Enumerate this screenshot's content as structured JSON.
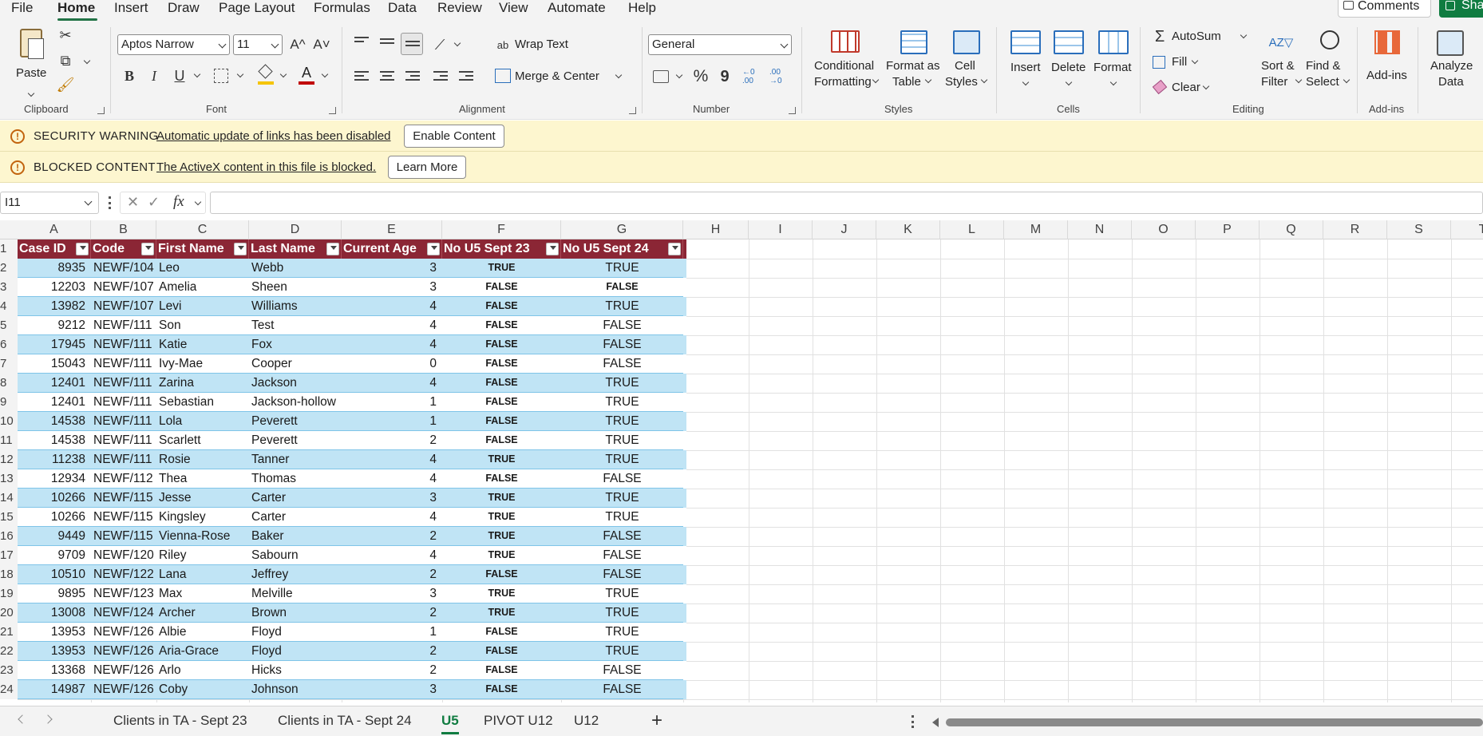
{
  "menu": {
    "tabs": [
      "File",
      "Home",
      "Insert",
      "Draw",
      "Page Layout",
      "Formulas",
      "Data",
      "Review",
      "View",
      "Automate",
      "Help"
    ],
    "comments_label": "Comments",
    "share_label": "Sha"
  },
  "ribbon": {
    "clipboard": {
      "paste_label": "Paste",
      "group_label": "Clipboard"
    },
    "font": {
      "font_name": "Aptos Narrow",
      "font_size": "11",
      "bold": "B",
      "italic": "I",
      "underline": "U",
      "grow": "A^",
      "shrink": "A˅",
      "font_color_letter": "A",
      "group_label": "Font",
      "fill_color": "#f5c400",
      "font_color": "#c00000"
    },
    "alignment": {
      "wrap_text": "Wrap Text",
      "merge_center": "Merge & Center",
      "group_label": "Alignment"
    },
    "number": {
      "format": "General",
      "percent": "%",
      "comma": "9",
      "inc_decimal": "←0 .00",
      "dec_decimal": ".00 →0",
      "group_label": "Number"
    },
    "styles": {
      "conditional_formatting": [
        "Conditional",
        "Formatting"
      ],
      "format_as_table": [
        "Format as",
        "Table"
      ],
      "cell_styles": [
        "Cell",
        "Styles"
      ],
      "group_label": "Styles"
    },
    "cells": {
      "insert": "Insert",
      "delete": "Delete",
      "format": "Format",
      "group_label": "Cells"
    },
    "editing": {
      "autosum": "AutoSum",
      "fill": "Fill",
      "clear": "Clear",
      "sort_filter": [
        "Sort &",
        "Filter"
      ],
      "find_select": [
        "Find &",
        "Select"
      ],
      "group_label": "Editing"
    },
    "addins": {
      "label": "Add-ins",
      "group_label": "Add-ins"
    },
    "analyze": {
      "label": [
        "Analyze",
        "Data"
      ]
    }
  },
  "messages": [
    {
      "title": "SECURITY WARNING",
      "text": "Automatic update of links has been disabled",
      "button": "Enable Content"
    },
    {
      "title": "BLOCKED CONTENT",
      "text": "The ActiveX content in this file is blocked.",
      "button": "Learn More"
    }
  ],
  "formula_bar": {
    "name_box": "I11",
    "fx": "fx",
    "formula": ""
  },
  "columns": [
    "A",
    "B",
    "C",
    "D",
    "E",
    "F",
    "G",
    "H",
    "I",
    "J",
    "K",
    "L",
    "M",
    "N",
    "O",
    "P",
    "Q",
    "R",
    "S",
    "T"
  ],
  "table": {
    "headers": [
      "Case ID",
      "Code",
      "First Name",
      "Last Name",
      "Current Age",
      "No U5 Sept 23",
      "No U5 Sept 24"
    ],
    "rows": [
      [
        "8935",
        "NEWF/104",
        "Leo",
        "Webb",
        "3",
        "TRUE",
        "TRUE"
      ],
      [
        "12203",
        "NEWF/107",
        "Amelia",
        "Sheen",
        "3",
        "FALSE",
        "FALSE"
      ],
      [
        "13982",
        "NEWF/107",
        "Levi",
        "Williams",
        "4",
        "FALSE",
        "TRUE"
      ],
      [
        "9212",
        "NEWF/111",
        "Son",
        "Test",
        "4",
        "FALSE",
        "FALSE"
      ],
      [
        "17945",
        "NEWF/111",
        "Katie",
        "Fox",
        "4",
        "FALSE",
        "FALSE"
      ],
      [
        "15043",
        "NEWF/111",
        "Ivy-Mae",
        "Cooper",
        "0",
        "FALSE",
        "FALSE"
      ],
      [
        "12401",
        "NEWF/111",
        "Zarina",
        "Jackson",
        "4",
        "FALSE",
        "TRUE"
      ],
      [
        "12401",
        "NEWF/111",
        "Sebastian",
        "Jackson-hollow",
        "1",
        "FALSE",
        "TRUE"
      ],
      [
        "14538",
        "NEWF/111",
        "Lola",
        "Peverett",
        "1",
        "FALSE",
        "TRUE"
      ],
      [
        "14538",
        "NEWF/111",
        "Scarlett",
        "Peverett",
        "2",
        "FALSE",
        "TRUE"
      ],
      [
        "11238",
        "NEWF/111",
        "Rosie",
        "Tanner",
        "4",
        "TRUE",
        "TRUE"
      ],
      [
        "12934",
        "NEWF/112",
        "Thea",
        "Thomas",
        "4",
        "FALSE",
        "FALSE"
      ],
      [
        "10266",
        "NEWF/115",
        "Jesse",
        "Carter",
        "3",
        "TRUE",
        "TRUE"
      ],
      [
        "10266",
        "NEWF/115",
        "Kingsley",
        "Carter",
        "4",
        "TRUE",
        "TRUE"
      ],
      [
        "9449",
        "NEWF/115",
        "Vienna-Rose",
        "Baker",
        "2",
        "TRUE",
        "FALSE"
      ],
      [
        "9709",
        "NEWF/120",
        "Riley",
        "Sabourn",
        "4",
        "TRUE",
        "FALSE"
      ],
      [
        "10510",
        "NEWF/122",
        "Lana",
        "Jeffrey",
        "2",
        "FALSE",
        "FALSE"
      ],
      [
        "9895",
        "NEWF/123",
        "Max",
        "Melville",
        "3",
        "TRUE",
        "TRUE"
      ],
      [
        "13008",
        "NEWF/124",
        "Archer",
        "Brown",
        "2",
        "TRUE",
        "TRUE"
      ],
      [
        "13953",
        "NEWF/126",
        "Albie",
        "Floyd",
        "1",
        "FALSE",
        "TRUE"
      ],
      [
        "13953",
        "NEWF/126",
        "Aria-Grace",
        "Floyd",
        "2",
        "FALSE",
        "TRUE"
      ],
      [
        "13368",
        "NEWF/126",
        "Arlo",
        "Hicks",
        "2",
        "FALSE",
        "FALSE"
      ],
      [
        "14987",
        "NEWF/126",
        "Coby",
        "Johnson",
        "3",
        "FALSE",
        "FALSE"
      ]
    ],
    "row_numbers": [
      "1",
      "2",
      "3",
      "4",
      "5",
      "6",
      "7",
      "8",
      "9",
      "10",
      "11",
      "12",
      "13",
      "14",
      "15",
      "16",
      "17",
      "18",
      "19",
      "20",
      "21",
      "22",
      "23",
      "24"
    ]
  },
  "sheets": [
    "Clients in TA - Sept 23",
    "Clients in TA - Sept 24",
    "U5",
    "PIVOT U12",
    "U12"
  ],
  "active_sheet": "U5",
  "add_sheet": "+",
  "colors": {
    "header_bg": "#8b2635",
    "band": "#c0e4f5",
    "accent": "#107c41"
  }
}
